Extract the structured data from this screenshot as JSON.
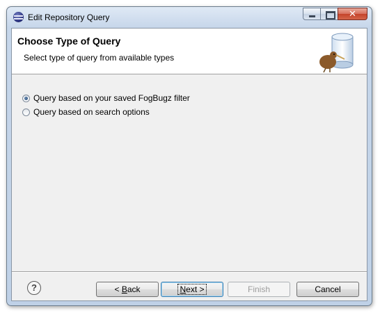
{
  "window": {
    "title": "Edit Repository Query"
  },
  "banner": {
    "title": "Choose Type of Query",
    "description": "Select type of query from available types"
  },
  "options": [
    {
      "label": "Query based on your saved FogBugz filter",
      "selected": true
    },
    {
      "label": "Query based on search options",
      "selected": false
    }
  ],
  "buttons": {
    "help": "?",
    "back_prefix": "< ",
    "back_mnemonic": "B",
    "back_rest": "ack",
    "next_mnemonic": "N",
    "next_rest": "ext >",
    "finish": "Finish",
    "cancel": "Cancel"
  },
  "colors": {
    "close_button": "#c4432b",
    "dialog_bg": "#f0f0f0",
    "title_bar": "#c6d6ea"
  }
}
